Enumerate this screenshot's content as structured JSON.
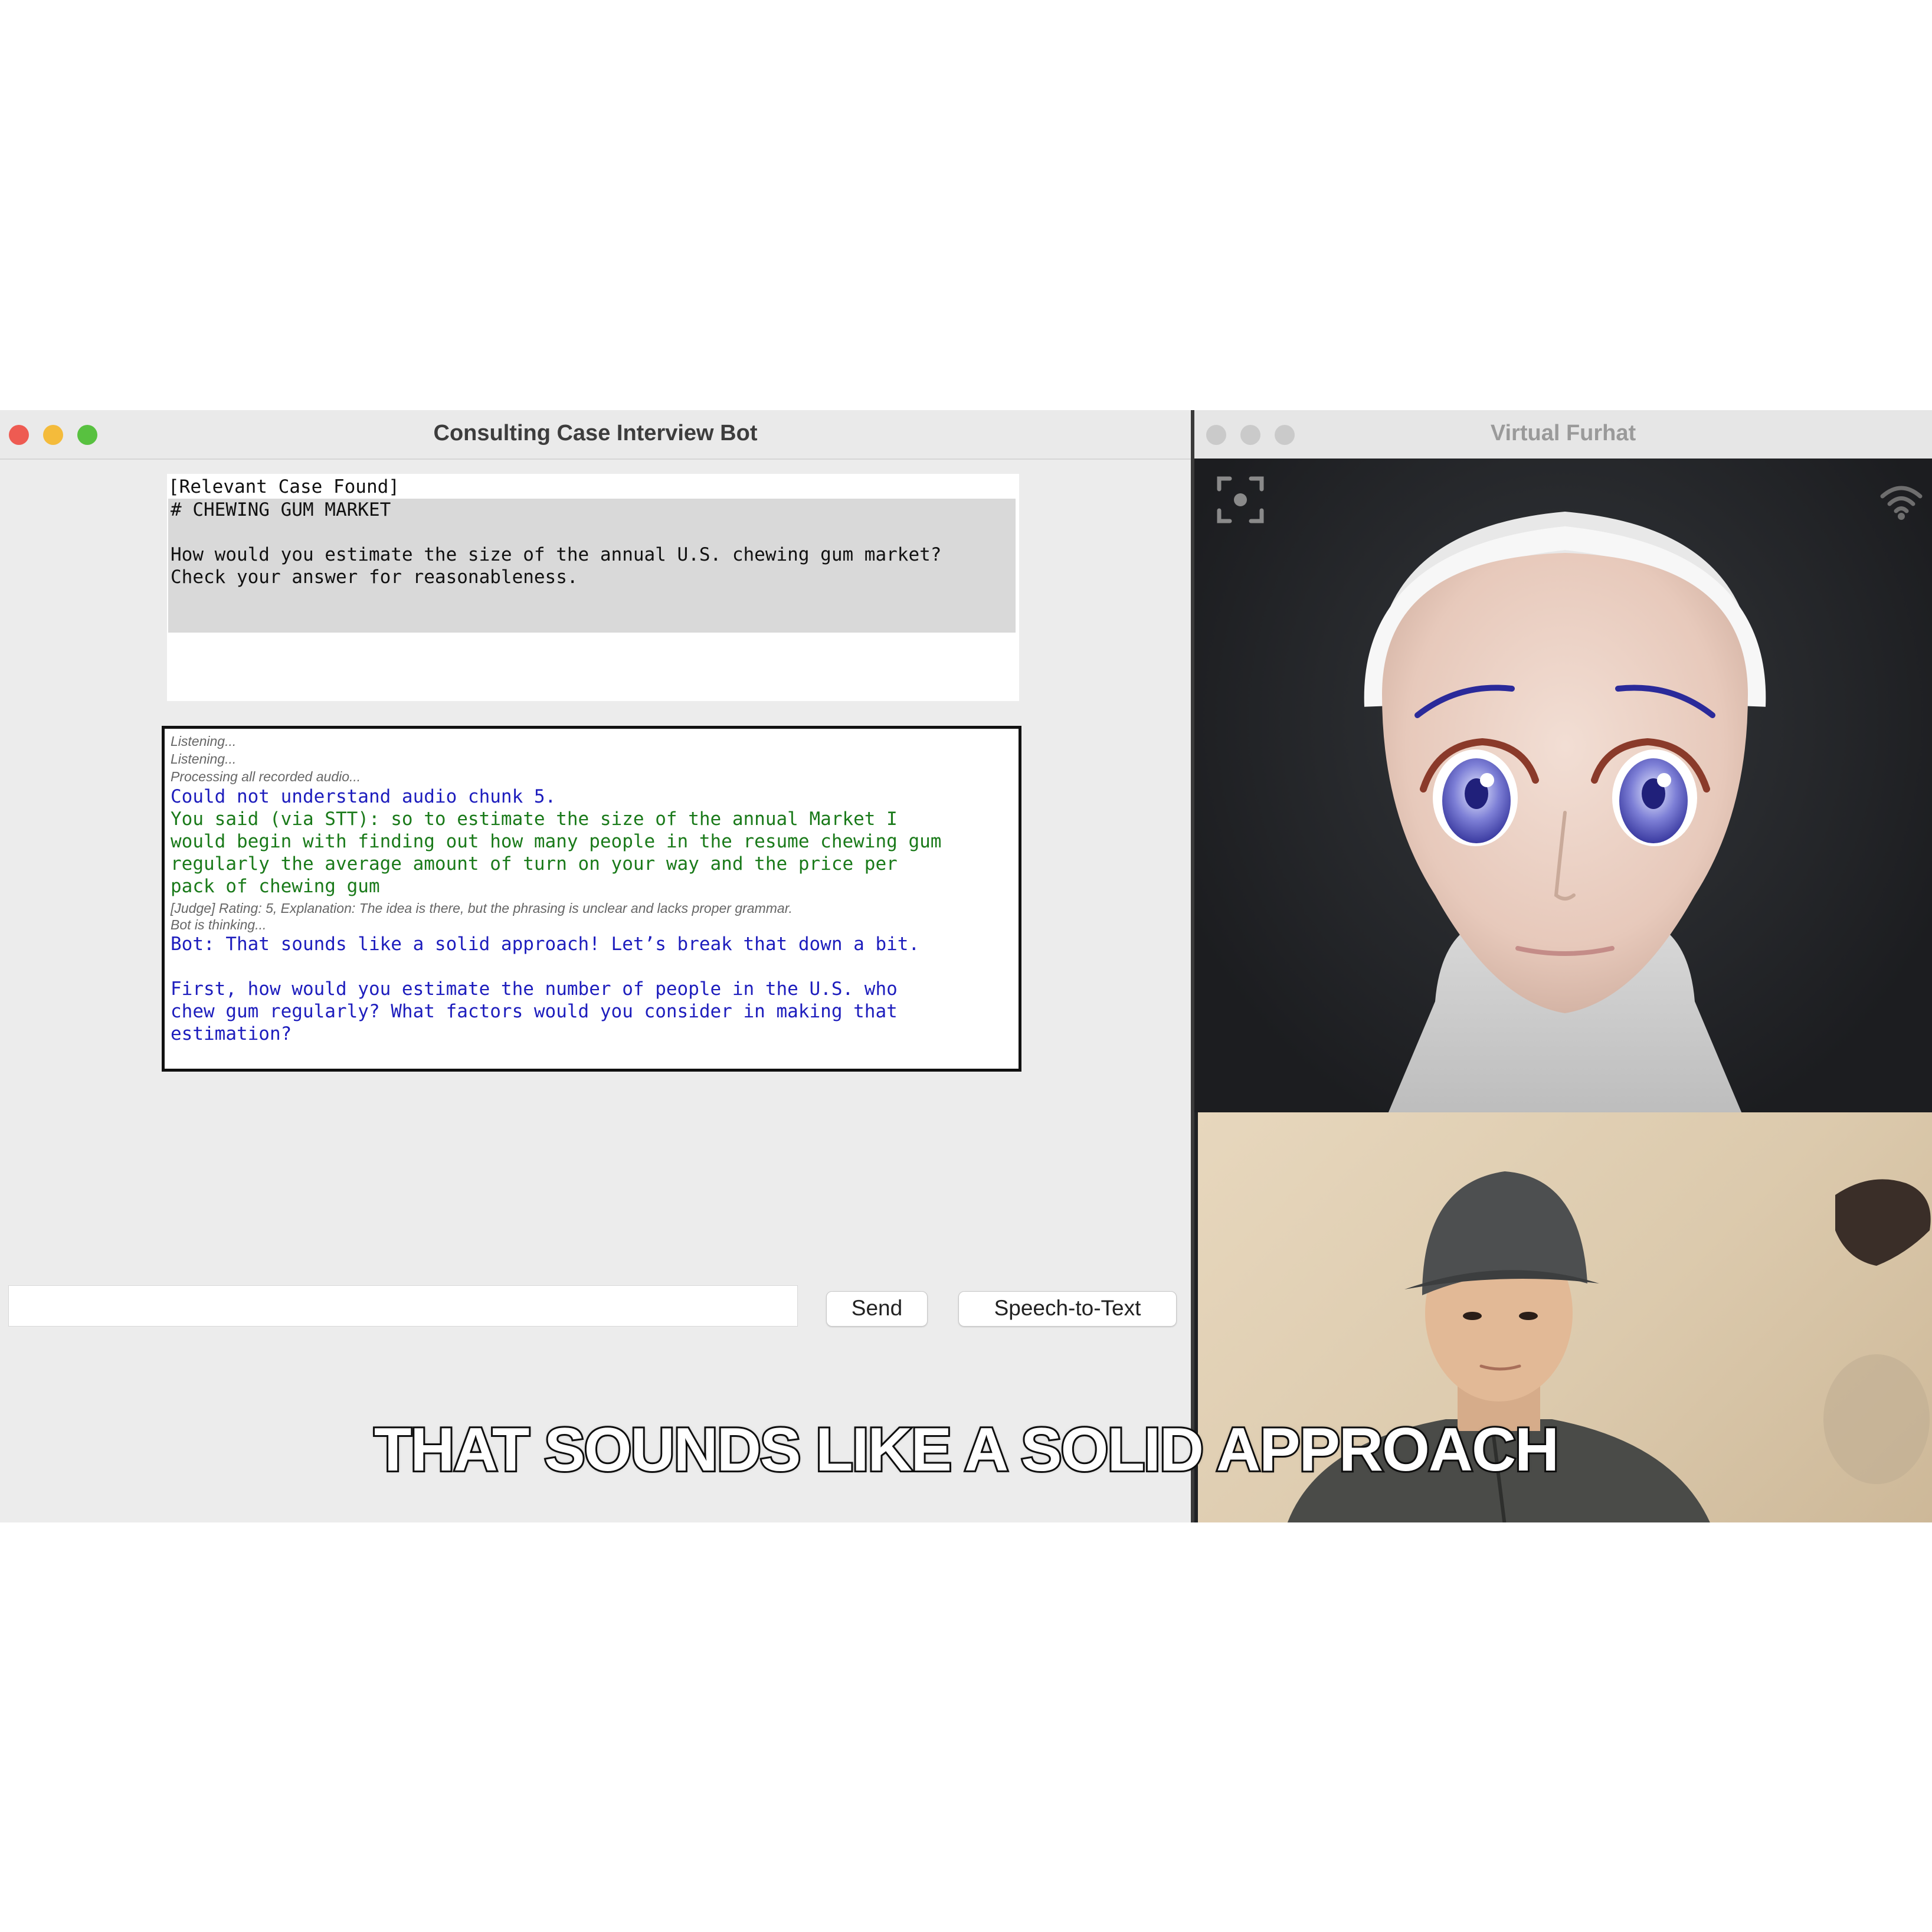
{
  "bot_window": {
    "title": "Consulting Case Interview Bot",
    "case_panel": {
      "header": "[Relevant Case Found]",
      "heading": "# CHEWING GUM MARKET",
      "question_line1": "How would you estimate the size of the annual U.S. chewing gum market?",
      "question_line2": "Check your answer for reasonableness."
    },
    "log": {
      "listening1": "Listening...",
      "listening2": "Listening...",
      "processing": "Processing all recorded audio...",
      "error": "Could not understand audio chunk 5.",
      "stt_lines": [
        "You said (via STT): so to estimate the size of the annual Market I",
        "would begin with finding out how many people in the resume chewing gum",
        "regularly the average amount of turn on your way and the price per",
        "pack of chewing gum"
      ],
      "judge": "[Judge] Rating: 5, Explanation: The idea is there, but the phrasing is unclear and lacks proper grammar.",
      "thinking": "Bot is thinking...",
      "bot_reply": "Bot: That sounds like a solid approach! Let’s break that down a bit.",
      "bot_followup_lines": [
        "First, how would you estimate the number of people in the U.S. who",
        "chew gum regularly? What factors would you consider in making that",
        "estimation?"
      ]
    },
    "input": {
      "value": "",
      "placeholder": ""
    },
    "send_label": "Send",
    "stt_label": "Speech-to-Text"
  },
  "furhat_window": {
    "title": "Virtual Furhat",
    "icons": [
      "focus-icon",
      "wifi-icon"
    ]
  },
  "caption": "THAT SOUNDS LIKE A SOLID APPROACH",
  "colors": {
    "bot_text": "#1d1dbd",
    "user_text": "#1a7a1a",
    "close": "#ee5b52",
    "minimize": "#f4bb3b",
    "maximize": "#58c140"
  }
}
